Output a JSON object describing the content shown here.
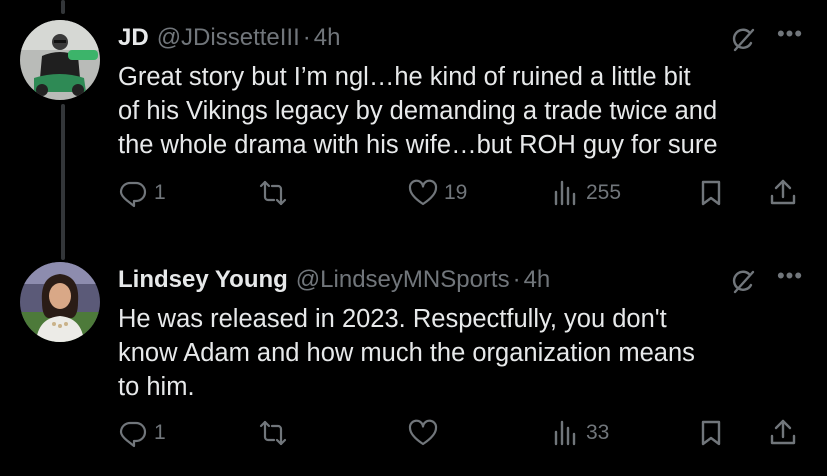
{
  "tweets": [
    {
      "name": "JD",
      "handle": "@JDissetteIII",
      "separator": "·",
      "time": "4h",
      "text_lines": [
        "Great story but I’m ngl…he kind of ruined a little bit",
        "of his Vikings legacy by demanding a trade twice and",
        "the whole drama with his wife…but ROH guy for sure"
      ],
      "replies": "1",
      "retweets": "",
      "likes": "19",
      "views": "255"
    },
    {
      "name": "Lindsey Young",
      "handle": "@LindseyMNSports",
      "separator": "·",
      "time": "4h",
      "text_lines": [
        "He was released in 2023. Respectfully, you don't",
        "know Adam and how much the organization means",
        "to him."
      ],
      "replies": "1",
      "retweets": "",
      "likes": "",
      "views": "33"
    }
  ],
  "icons": {
    "reply": "reply-icon",
    "retweet": "retweet-icon",
    "like": "heart-icon",
    "views": "views-icon",
    "bookmark": "bookmark-icon",
    "share": "share-icon",
    "grok": "grok-icon",
    "more": "more-icon"
  },
  "colors": {
    "background": "#000000",
    "text": "#e7e9ea",
    "muted": "#71767b",
    "thread_line": "#333639"
  }
}
